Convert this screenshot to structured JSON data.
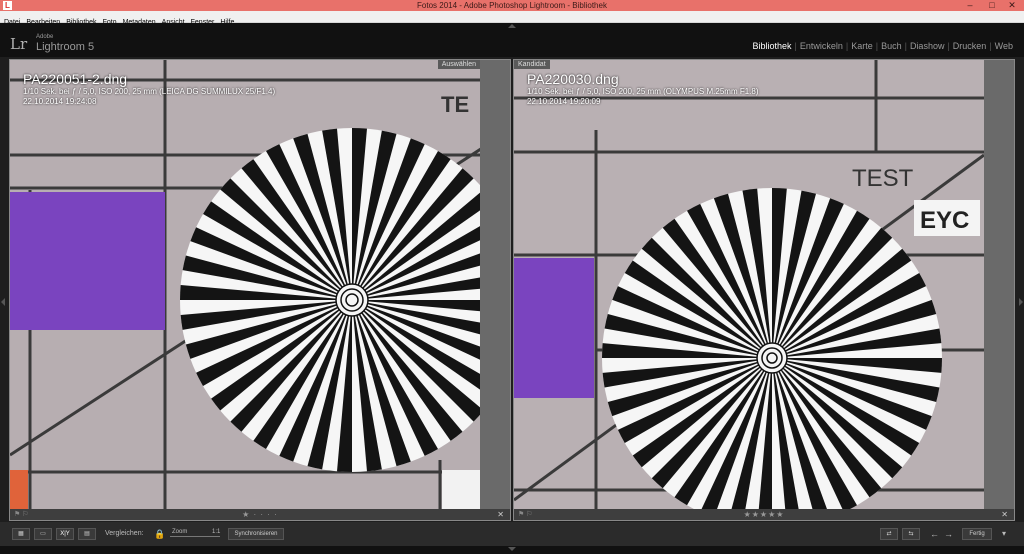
{
  "window": {
    "title": "Fotos 2014 - Adobe Photoshop Lightroom - Bibliothek",
    "minimize": "–",
    "maximize": "□",
    "close": "✕"
  },
  "menu": [
    "Datei",
    "Bearbeiten",
    "Bibliothek",
    "Foto",
    "Metadaten",
    "Ansicht",
    "Fenster",
    "Hilfe"
  ],
  "identity": {
    "logo": "Lr",
    "brand": "Adobe",
    "product": "Lightroom 5"
  },
  "modules": [
    "Bibliothek",
    "Entwickeln",
    "Karte",
    "Buch",
    "Diashow",
    "Drucken",
    "Web"
  ],
  "left_panel": {
    "tag": "Auswählen",
    "filename": "PA220051-2.dng",
    "exposure": "1/10 Sek. bei ƒ / 5,0, ISO 200, 25 mm (LEICA DG SUMMILUX 25/F1.4)",
    "date": "22.10.2014 19:24:08",
    "chart_text": "TE",
    "rating": "★ · · · ·",
    "close": "✕"
  },
  "right_panel": {
    "tag": "Kandidat",
    "filename": "PA220030.dng",
    "exposure": "1/10 Sek. bei ƒ / 5,0, ISO 200, 25 mm (OLYMPUS M.25mm F1.8)",
    "date": "22.10.2014 19:20:09",
    "chart_text": "TEST",
    "chart_box": "EYC",
    "rating": "★★★★★",
    "close": "✕"
  },
  "toolbar": {
    "compare_label": "Vergleichen:",
    "zoom_label": "Zoom",
    "zoom_value": "1:1",
    "sync_button": "Synchronisieren",
    "done_button": "Fertig",
    "xy_label": "X|Y"
  }
}
